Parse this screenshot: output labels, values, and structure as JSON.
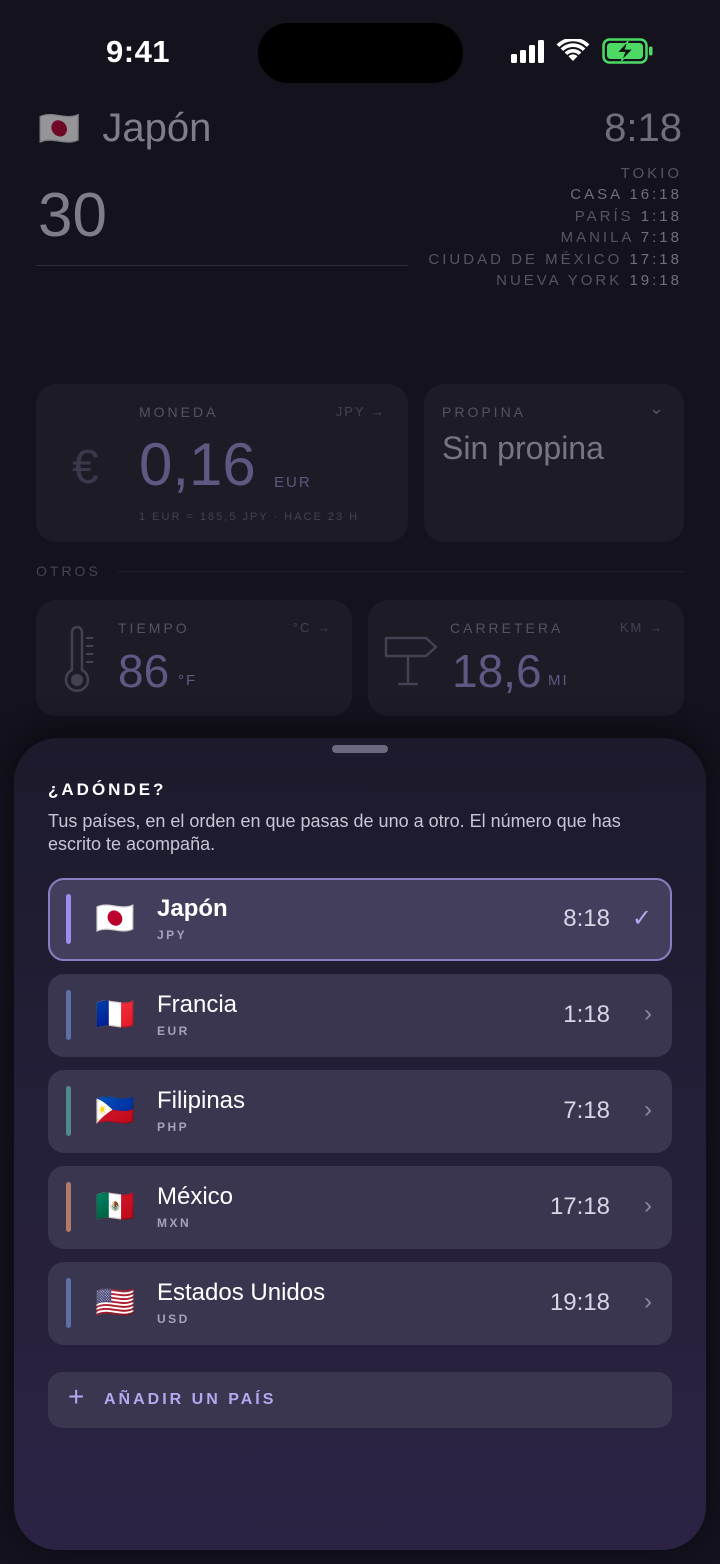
{
  "status_bar": {
    "time": "9:41",
    "battery_color": "#4cd964"
  },
  "header": {
    "flag": "🇯🇵",
    "country": "Japón",
    "amount": "30",
    "local_time": "8:18",
    "clocks": [
      {
        "label": "TOKIO",
        "time": ""
      },
      {
        "label": "CASA",
        "time": "16:18"
      },
      {
        "label": "PARÍS",
        "time": "1:18"
      },
      {
        "label": "MANILA",
        "time": "7:18"
      },
      {
        "label": "CIUDAD DE MÉXICO",
        "time": "17:18"
      },
      {
        "label": "NUEVA YORK",
        "time": "19:18"
      }
    ]
  },
  "cards": {
    "currency": {
      "label": "MONEDA",
      "unit": "JPY →",
      "symbol": "€",
      "value": "0,16",
      "value_unit": "EUR",
      "footnote": "1 EUR = 185,5 JPY · HACE 23 H"
    },
    "tip": {
      "label": "PROPINA",
      "chevron": "⌄",
      "value": "Sin propina"
    },
    "others_label": "OTROS",
    "weather": {
      "label": "TIEMPO",
      "unit": "°C →",
      "value": "86",
      "value_unit": "°F"
    },
    "road": {
      "label": "CARRETERA",
      "unit": "KM →",
      "value": "18,6",
      "value_unit": "MI"
    }
  },
  "sheet": {
    "title": "¿ADÓNDE?",
    "description": "Tus países, en el orden en que pasas de uno a otro. El número que has escrito te acompaña.",
    "countries": [
      {
        "flag": "🇯🇵",
        "name": "Japón",
        "code": "JPY",
        "time": "8:18",
        "action": "✓",
        "accent": "#9b8cf0",
        "selected": true
      },
      {
        "flag": "🇫🇷",
        "name": "Francia",
        "code": "EUR",
        "time": "1:18",
        "action": "›",
        "accent": "#5f6fa8",
        "selected": false
      },
      {
        "flag": "🇵🇭",
        "name": "Filipinas",
        "code": "PHP",
        "time": "7:18",
        "action": "›",
        "accent": "#4f8a8c",
        "selected": false
      },
      {
        "flag": "🇲🇽",
        "name": "México",
        "code": "MXN",
        "time": "17:18",
        "action": "›",
        "accent": "#b07a68",
        "selected": false
      },
      {
        "flag": "🇺🇸",
        "name": "Estados Unidos",
        "code": "USD",
        "time": "19:18",
        "action": "›",
        "accent": "#5f6fa8",
        "selected": false
      }
    ],
    "add_label": "AÑADIR UN PAÍS",
    "add_icon": "+"
  }
}
